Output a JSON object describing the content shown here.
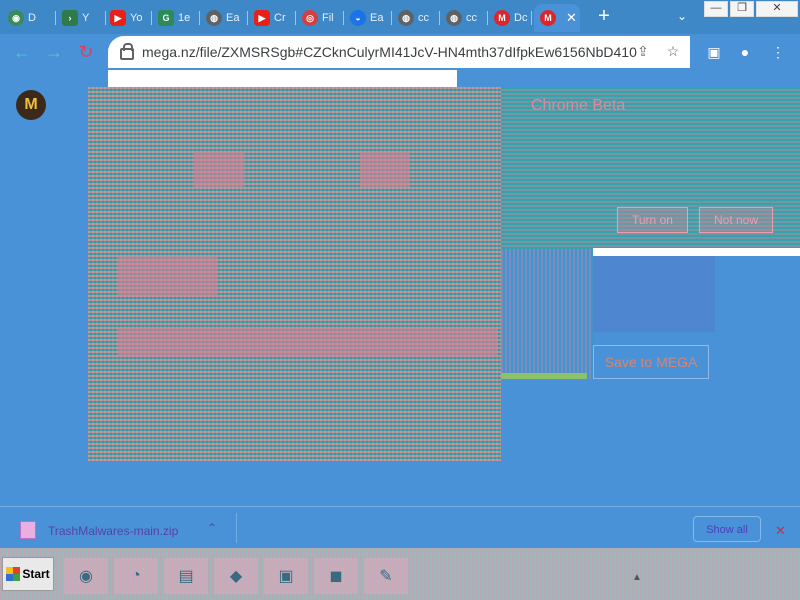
{
  "tabs": [
    {
      "label": "D",
      "icon": "globe-icon",
      "color": "#3a8a5a"
    },
    {
      "label": "Y",
      "icon": "terminal-icon",
      "color": "#2f7a4a"
    },
    {
      "label": "Yo",
      "icon": "youtube-icon",
      "color": "#e62117"
    },
    {
      "label": "1e",
      "icon": "grammarly-icon",
      "color": "#2d8a5a"
    },
    {
      "label": "Ea",
      "icon": "globe-icon",
      "color": "#5f6368"
    },
    {
      "label": "Cr",
      "icon": "youtube-icon",
      "color": "#e62117"
    },
    {
      "label": "Fil",
      "icon": "site-icon",
      "color": "#d04040"
    },
    {
      "label": "Ea",
      "icon": "edge-icon",
      "color": "#1a73e8"
    },
    {
      "label": "cc",
      "icon": "globe-icon",
      "color": "#5f6368"
    },
    {
      "label": "cc",
      "icon": "globe-icon",
      "color": "#5f6368"
    },
    {
      "label": "Dc",
      "icon": "mega-icon",
      "color": "#d9272e"
    },
    {
      "label": "",
      "icon": "mega-icon",
      "color": "#d9272e",
      "active": true
    }
  ],
  "toolbar": {
    "url": "mega.nz/file/ZXMSRSgb#CZCknCulyrMI41JcV-HN4mth37dIfpkEw6156NbD410"
  },
  "page": {
    "logo_letter": "M",
    "banner_title": "Chrome Beta",
    "turn_on_label": "Turn on",
    "not_now_label": "Not now",
    "save_label": "Save to MEGA",
    "download_progress": 0.93
  },
  "downloads": {
    "file_name": "TrashMalwares-main.zip",
    "show_all_label": "Show all"
  },
  "taskbar": {
    "start_label": "Start"
  }
}
